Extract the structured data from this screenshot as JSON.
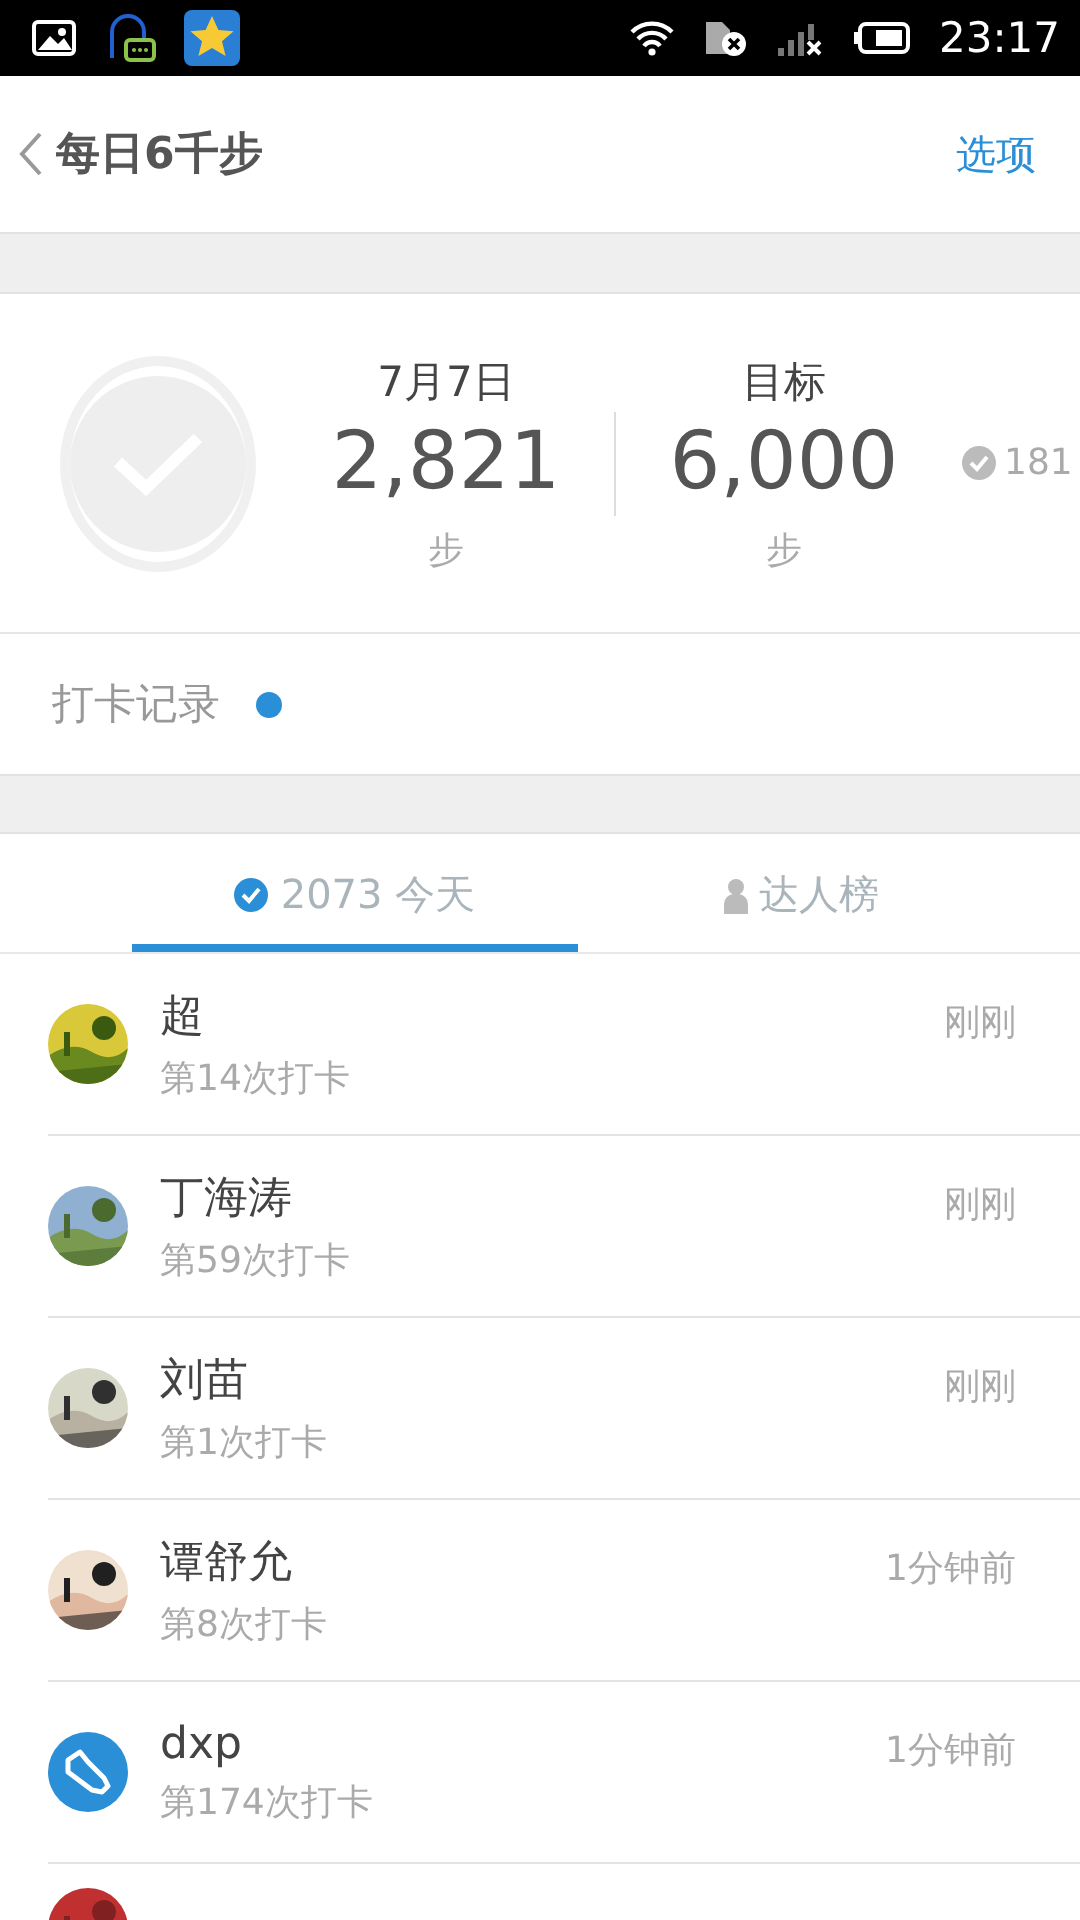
{
  "status_bar": {
    "time": "23:17"
  },
  "header": {
    "title": "每日6千步",
    "action": "选项"
  },
  "stats": {
    "completed": false,
    "badge_count": "181",
    "columns": [
      {
        "label": "7月7日",
        "value": "2,821",
        "unit": "步"
      },
      {
        "label": "目标",
        "value": "6,000",
        "unit": "步"
      }
    ]
  },
  "checkin_record": {
    "label": "打卡记录",
    "unread": true
  },
  "tabs": [
    {
      "kind": "check",
      "label": "2073 今天",
      "selected": true
    },
    {
      "kind": "person",
      "label": "达人榜",
      "selected": false
    }
  ],
  "users": [
    {
      "kind": "picture",
      "name": "超",
      "count": "第14次打卡",
      "time": "刚刚"
    },
    {
      "kind": "picture",
      "name": "丁海涛",
      "count": "第59次打卡",
      "time": "刚刚"
    },
    {
      "kind": "picture",
      "name": "刘苗",
      "count": "第1次打卡",
      "time": "刚刚"
    },
    {
      "kind": "picture",
      "name": "谭舒允",
      "count": "第8次打卡",
      "time": "1分钟前"
    },
    {
      "kind": "shoe",
      "name": "dxp",
      "count": "第174次打卡",
      "time": "1分钟前"
    },
    {
      "kind": "picture"
    }
  ]
}
